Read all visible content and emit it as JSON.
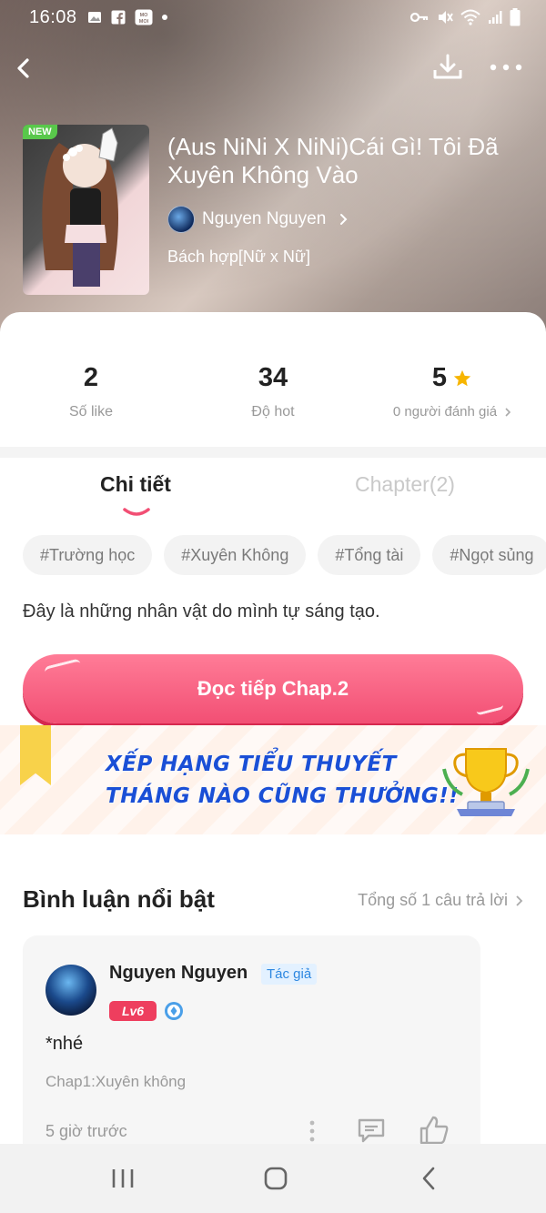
{
  "status_bar": {
    "time": "16:08",
    "left_icons": [
      "image-icon",
      "facebook-icon",
      "momoi-icon",
      "dot-icon"
    ],
    "right_icons": [
      "key-icon",
      "mute-icon",
      "wifi-icon",
      "signal-icon",
      "battery-icon"
    ]
  },
  "header": {
    "back_icon": "chevron-left-icon",
    "download_icon": "download-icon",
    "more_icon": "more-icon"
  },
  "story": {
    "badge": "NEW",
    "title": "(Aus NiNi X NiNi)Cái Gì! Tôi Đã Xuyên Không Vào",
    "author": "Nguyen Nguyen",
    "genre": "Bách hợp[Nữ x Nữ]"
  },
  "stats": {
    "likes_value": "2",
    "likes_label": "Số like",
    "hot_value": "34",
    "hot_label": "Độ hot",
    "rating_value": "5",
    "rating_label": "0 người đánh giá"
  },
  "tabs": {
    "detail": "Chi tiết",
    "chapter": "Chapter(2)"
  },
  "tags": [
    "#Trường học",
    "#Xuyên Không",
    "#Tổng tài",
    "#Ngọt sủng"
  ],
  "description": "Đây là những nhân vật do mình tự sáng tạo.",
  "read_button": "Đọc tiếp Chap.2",
  "banner": {
    "line1": "XẾP HẠNG TIỂU THUYẾT",
    "line2": "THÁNG NÀO CŨNG THƯỞNG!!"
  },
  "comments_section": {
    "title": "Bình luận nổi bật",
    "total_link": "Tổng số 1 câu trả lời"
  },
  "comment": {
    "user": "Nguyen Nguyen",
    "author_tag": "Tác giả",
    "level": "Lv6",
    "text": "*nhé",
    "chapter": "Chap1:Xuyên không",
    "time": "5 giờ trước"
  },
  "colors": {
    "accent_pink": "#f24f74",
    "tab_underline": "#f24f74",
    "star": "#f7b500",
    "banner_text": "#1a4fd6",
    "author_tag_bg": "#e3f1ff",
    "level_badge": "#ee3e5e"
  }
}
